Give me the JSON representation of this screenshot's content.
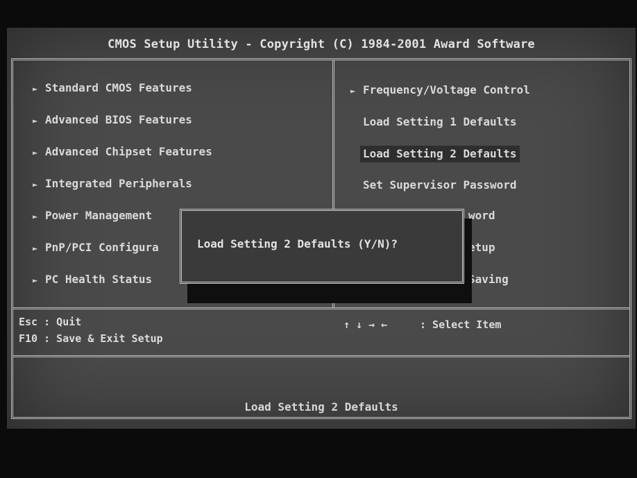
{
  "title": "CMOS Setup Utility - Copyright (C) 1984-2001 Award Software",
  "left_menu": [
    {
      "label": "Standard CMOS Features",
      "arrow": "►"
    },
    {
      "label": "Advanced BIOS Features",
      "arrow": "►"
    },
    {
      "label": "Advanced Chipset Features",
      "arrow": "►"
    },
    {
      "label": "Integrated Peripherals",
      "arrow": "►"
    },
    {
      "label": "Power Management",
      "arrow": "►"
    },
    {
      "label": "PnP/PCI Configura",
      "arrow": "►"
    },
    {
      "label": "PC Health Status",
      "arrow": "►"
    }
  ],
  "right_menu": [
    {
      "label": "Frequency/Voltage Control",
      "arrow": "►"
    },
    {
      "label": "Load Setting 1 Defaults",
      "arrow": ""
    },
    {
      "label": "Load Setting 2 Defaults",
      "arrow": "",
      "selected": true
    },
    {
      "label": "Set Supervisor Password",
      "arrow": ""
    },
    {
      "label": "word",
      "arrow": ""
    },
    {
      "label": "etup",
      "arrow": ""
    },
    {
      "label": "Saving",
      "arrow": ""
    }
  ],
  "keys": {
    "esc": "Esc : Quit",
    "f10": "F10 : Save & Exit Setup",
    "arrows": "↑ ↓ → ←",
    "select": ": Select Item"
  },
  "status_line": "Load Setting 2 Defaults",
  "dialog": {
    "prompt": "Load Setting 2 Defaults (Y/N)?"
  }
}
